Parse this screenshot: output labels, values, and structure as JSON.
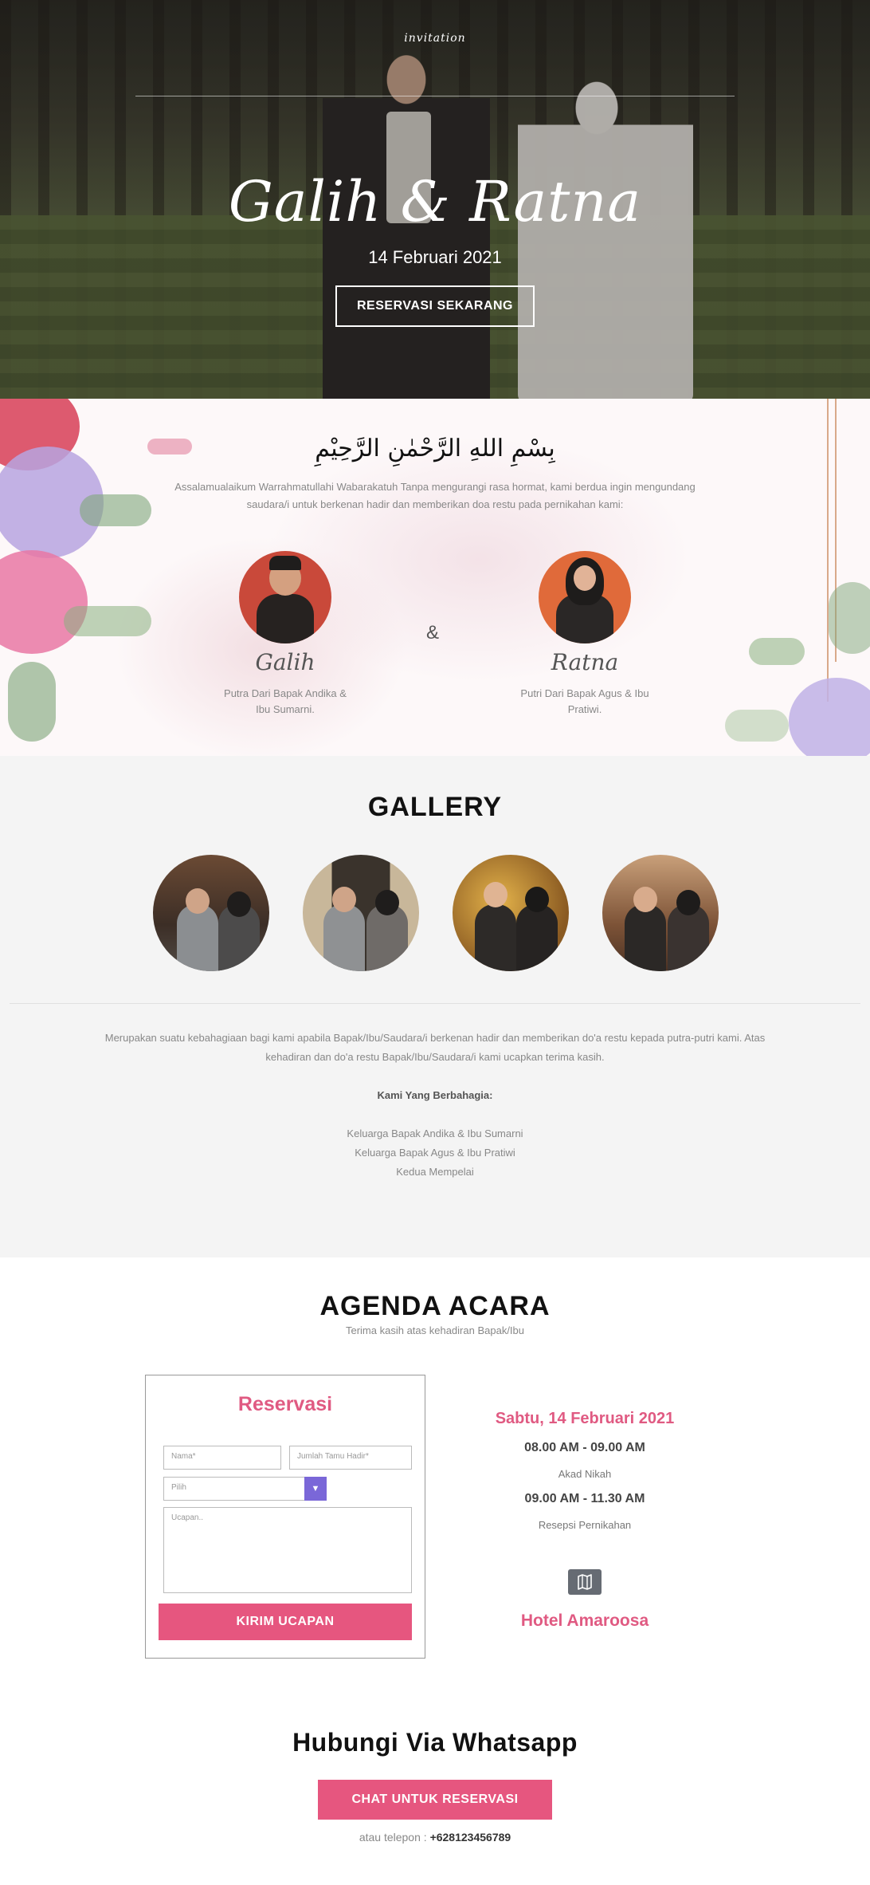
{
  "hero": {
    "logo": "invitation",
    "couple": "Galih & Ratna",
    "date": "14 Februari 2021",
    "cta": "RESERVASI SEKARANG"
  },
  "intro": {
    "bismillah": "بِسْمِ اللهِ الرَّحْمٰنِ الرَّحِيْمِ",
    "text": "Assalamualaikum Warrahmatullahi Wabarakatuh Tanpa mengurangi rasa hormat, kami berdua ingin mengundang saudara/i untuk berkenan hadir dan memberikan doa restu pada pernikahan kami:",
    "ampersand": "&",
    "groom": {
      "name": "Galih",
      "desc": "Putra Dari Bapak Andika & Ibu Sumarni."
    },
    "bride": {
      "name": "Ratna",
      "desc": "Putri Dari Bapak Agus & Ibu Pratiwi."
    }
  },
  "gallery": {
    "title": "GALLERY",
    "message": "Merupakan suatu kebahagiaan bagi kami apabila Bapak/Ibu/Saudara/i berkenan hadir dan memberikan do'a restu kepada putra-putri kami. Atas kehadiran dan do'a restu Bapak/Ibu/Saudara/i kami ucapkan terima kasih.",
    "signoff_title": "Kami Yang Berbahagia:",
    "families": [
      "Keluarga Bapak Andika & Ibu Sumarni",
      "Keluarga Bapak Agus & Ibu Pratiwi",
      "Kedua Mempelai"
    ]
  },
  "agenda": {
    "title": "AGENDA ACARA",
    "subtitle": "Terima kasih atas kehadiran Bapak/Ibu",
    "form": {
      "title": "Reservasi",
      "name_placeholder": "Nama*",
      "guests_placeholder": "Jumlah Tamu Hadir*",
      "select_value": "Pilih",
      "message_placeholder": "Ucapan..",
      "submit": "KIRIM UCAPAN"
    },
    "event": {
      "date": "Sabtu, 14 Februari 2021",
      "time1": "08.00 AM - 09.00 AM",
      "label1": "Akad Nikah",
      "time2": "09.00 AM - 11.30 AM",
      "label2": "Resepsi Pernikahan",
      "map_icon": "map-icon",
      "venue": "Hotel Amaroosa"
    }
  },
  "whatsapp": {
    "title": "Hubungi Via Whatsapp",
    "button": "CHAT UNTUK RESERVASI",
    "phone_prefix": "atau telepon :",
    "phone": "+628123456789"
  }
}
